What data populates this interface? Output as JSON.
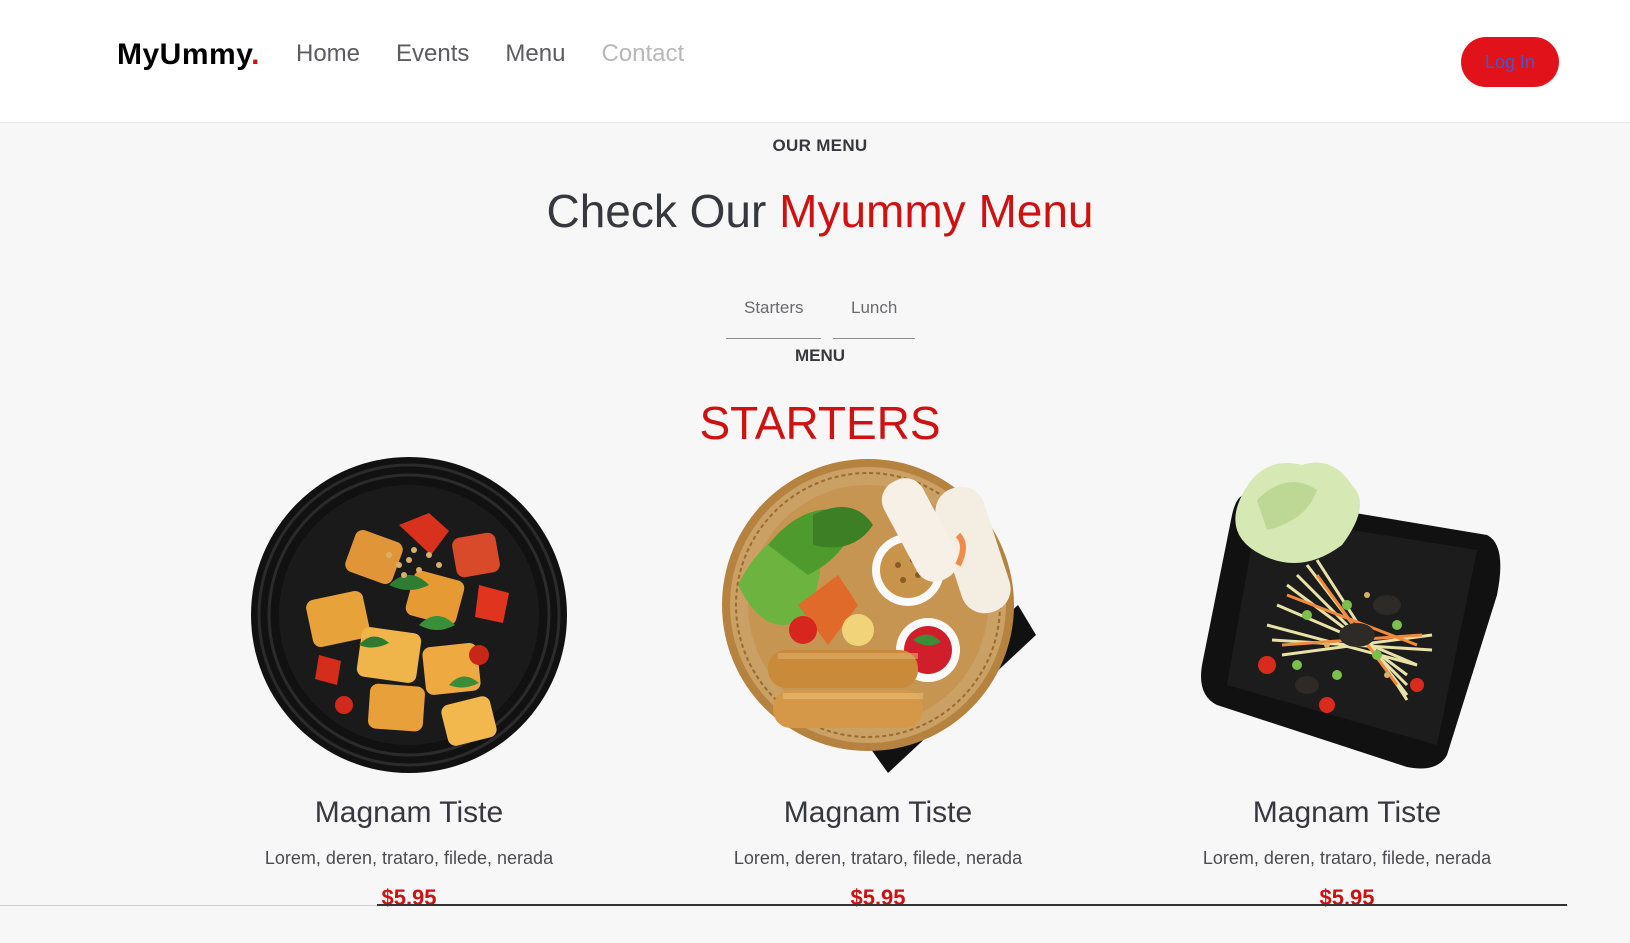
{
  "brand": {
    "name": "MyUmmy",
    "dot": "."
  },
  "nav": {
    "items": [
      {
        "label": "Home"
      },
      {
        "label": "Events"
      },
      {
        "label": "Menu"
      },
      {
        "label": "Contact"
      }
    ]
  },
  "header": {
    "login_label": "Log In"
  },
  "menu_section": {
    "eyebrow": "OUR MENU",
    "title_plain": "Check Our ",
    "title_accent": "Myummy Menu",
    "tabs": [
      {
        "label": "Starters"
      },
      {
        "label": "Lunch"
      }
    ],
    "sub_label": "MENU",
    "section_title": "STARTERS"
  },
  "items": [
    {
      "name": "Magnam Tiste",
      "desc": "Lorem, deren, trataro, filede, nerada",
      "price": "$5.95",
      "image": "tofu-bowl"
    },
    {
      "name": "Magnam Tiste",
      "desc": "Lorem, deren, trataro, filede, nerada",
      "price": "$5.95",
      "image": "spring-roll-basket"
    },
    {
      "name": "Magnam Tiste",
      "desc": "Lorem, deren, trataro, filede, nerada",
      "price": "$5.95",
      "image": "papaya-salad-plate"
    }
  ],
  "colors": {
    "accent": "#ce1212",
    "button": "#e1121a",
    "text": "#37373f",
    "background": "#f7f7f7"
  }
}
